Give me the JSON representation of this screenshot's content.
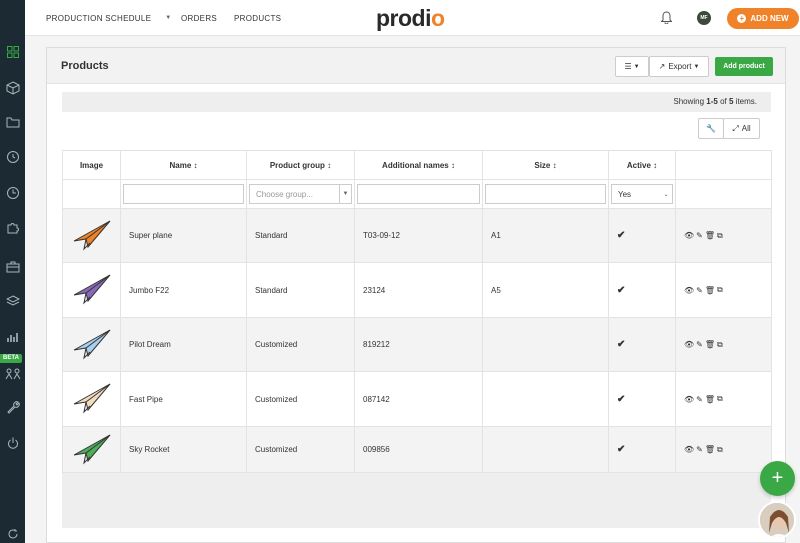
{
  "sidebar": {
    "beta_label": "BETA",
    "icons": [
      "dashboard-icon",
      "box-icon",
      "folder-icon",
      "history-icon",
      "clock-icon",
      "puzzle-icon",
      "briefcase-icon",
      "layers-icon",
      "chart-icon",
      "team-icon",
      "wrench-icon",
      "power-icon",
      "refresh-icon"
    ]
  },
  "topnav": {
    "items": [
      "PRODUCTION SCHEDULE",
      "ORDERS",
      "PRODUCTS"
    ]
  },
  "logo": {
    "text_a": "prod",
    "text_b": "i",
    "text_c": "o"
  },
  "user": {
    "initials": "MF"
  },
  "add_new": "ADD NEW",
  "panel": {
    "title": "Products",
    "export_label": "Export",
    "add_product_label": "Add product"
  },
  "grid": {
    "summary_pre": "Showing ",
    "summary_range": "1-5",
    "summary_mid": " of ",
    "summary_total": "5",
    "summary_post": " items.",
    "all_label": "All",
    "columns": [
      "Image",
      "Name ↕",
      "Product group ↕",
      "Additional names ↕",
      "Size ↕",
      "Active ↕"
    ],
    "filters": {
      "group_placeholder": "Choose group...",
      "active_value": "Yes"
    },
    "rows": [
      {
        "name": "Super plane",
        "group": "Standard",
        "additional": "T03-09-12",
        "size": "A1",
        "active": "✔",
        "color": "#f0822a"
      },
      {
        "name": "Jumbo F22",
        "group": "Standard",
        "additional": "23124",
        "size": "A5",
        "active": "✔",
        "color": "#8a6ab8"
      },
      {
        "name": "Pilot Dream",
        "group": "Customized",
        "additional": "819212",
        "size": "",
        "active": "✔",
        "color": "#a9cff0"
      },
      {
        "name": "Fast Pipe",
        "group": "Customized",
        "additional": "087142",
        "size": "",
        "active": "✔",
        "color": "#f2dcc0"
      },
      {
        "name": "Sky Rocket",
        "group": "Customized",
        "additional": "009856",
        "size": "",
        "active": "✔",
        "color": "#4fae5c"
      }
    ]
  },
  "colors": {
    "accent": "#f0822a",
    "green": "#3aa845",
    "sidebar": "#1b2a33"
  }
}
